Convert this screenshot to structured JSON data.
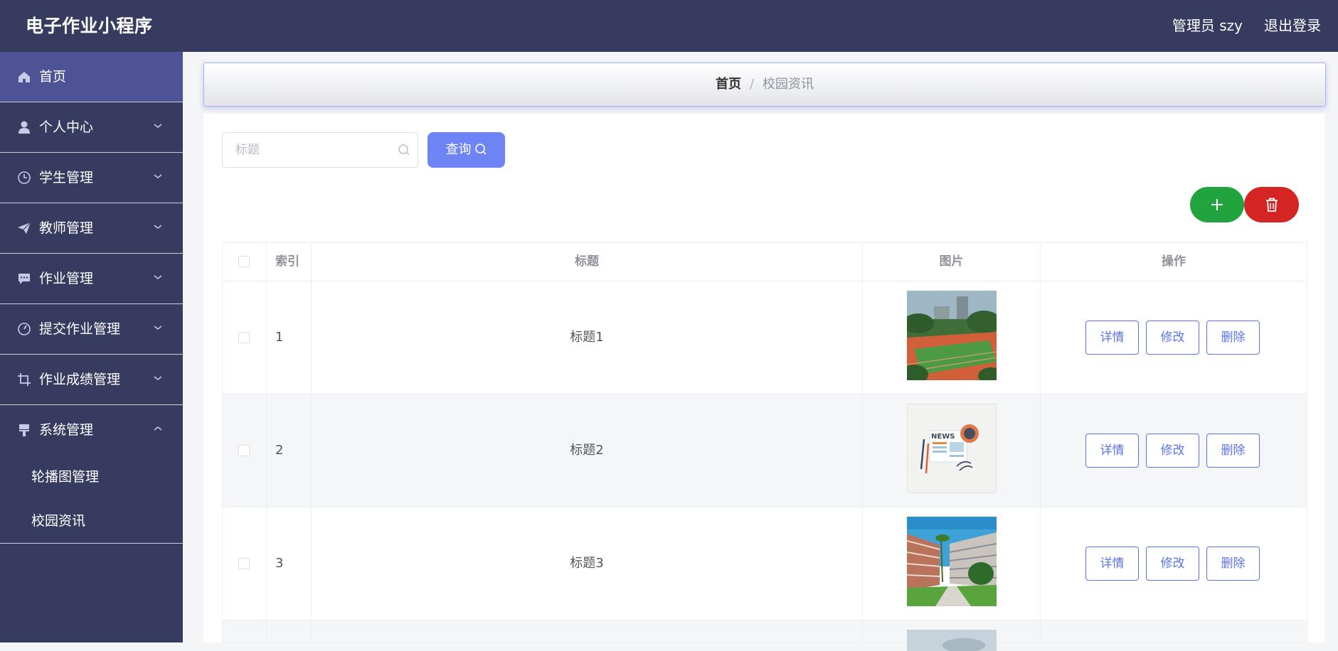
{
  "header": {
    "title": "电子作业小程序",
    "user": "管理员 szy",
    "logout": "退出登录"
  },
  "sidebar": {
    "items": [
      {
        "label": "首页",
        "icon": "home-icon",
        "active": true
      },
      {
        "label": "个人中心",
        "icon": "user-icon"
      },
      {
        "label": "学生管理",
        "icon": "clock-icon"
      },
      {
        "label": "教师管理",
        "icon": "paper-plane-icon"
      },
      {
        "label": "作业管理",
        "icon": "chat-icon"
      },
      {
        "label": "提交作业管理",
        "icon": "gauge-icon"
      },
      {
        "label": "作业成绩管理",
        "icon": "crop-icon"
      },
      {
        "label": "系统管理",
        "icon": "brush-icon",
        "expanded": true
      }
    ],
    "subitems": [
      {
        "label": "轮播图管理"
      },
      {
        "label": "校园资讯"
      }
    ]
  },
  "breadcrumb": {
    "home": "首页",
    "separator": "/",
    "current": "校园资讯"
  },
  "search": {
    "placeholder": "标题",
    "value": "",
    "button": "查询"
  },
  "table": {
    "headers": {
      "index": "索引",
      "title": "标题",
      "image": "图片",
      "actions": "操作"
    },
    "rows": [
      {
        "index": "1",
        "title": "标题1",
        "image": "campus-sports-field"
      },
      {
        "index": "2",
        "title": "标题2",
        "image": "news-illustration",
        "image_text": "NEWS"
      },
      {
        "index": "3",
        "title": "标题3",
        "image": "campus-building"
      }
    ],
    "actions": {
      "detail": "详情",
      "edit": "修改",
      "delete": "删除"
    }
  },
  "colors": {
    "topbar": "#373b5f",
    "sidebar_active": "#4d5395",
    "primary": "#6e84f5",
    "add": "#21a33e",
    "delete": "#d42524",
    "link": "#5b73f0"
  }
}
